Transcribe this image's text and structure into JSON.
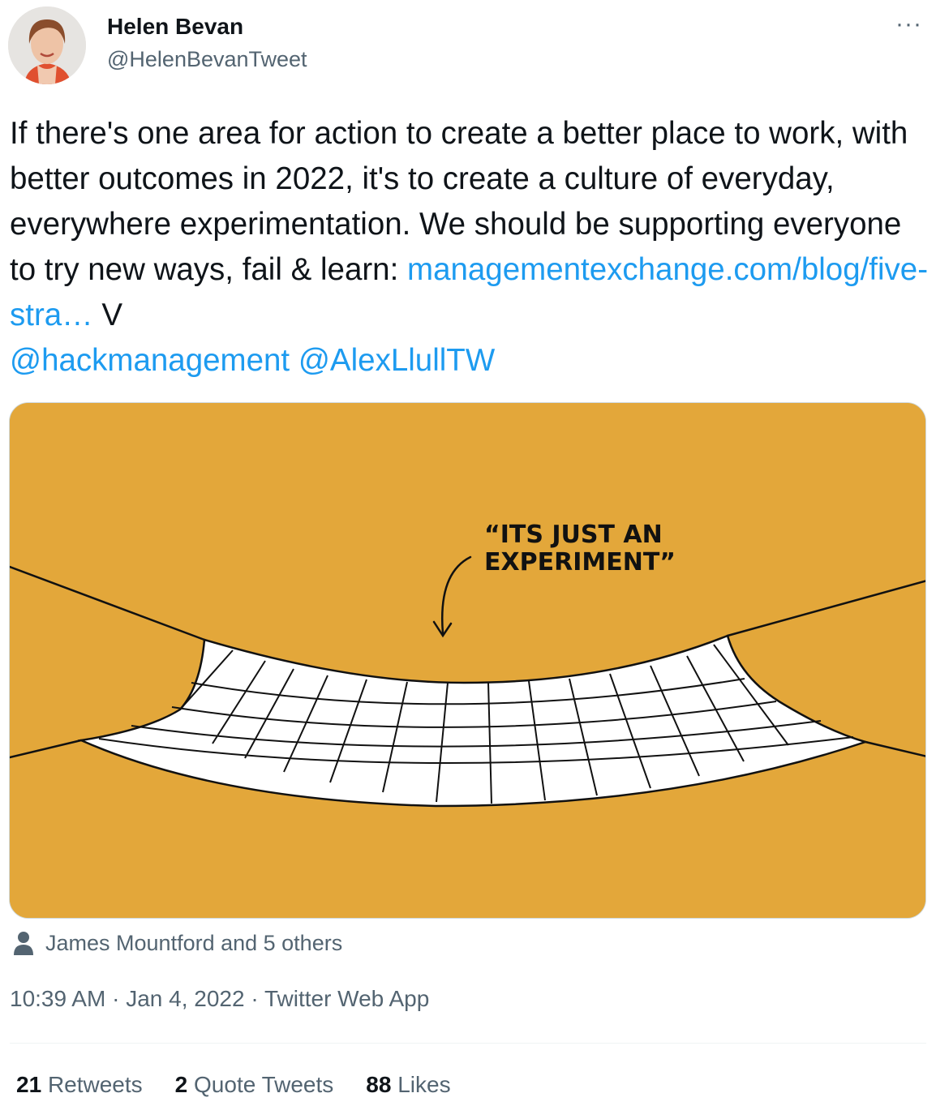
{
  "author": {
    "name": "Helen Bevan",
    "handle": "@HelenBevanTweet"
  },
  "more_label": "···",
  "tweet": {
    "text_1": "If there's one area for action to create a better place to work, with better outcomes in 2022, it's to create a culture of everyday, everywhere experimentation. We should be supporting everyone to try new ways, fail & learn: ",
    "link": "managementexchange.com/blog/five-stra…",
    "text_2": " V ",
    "mention_1": "@hackmanagement",
    "mention_2": "@AlexLlullTW"
  },
  "media": {
    "caption_line1": "“ITS JUST AN",
    "caption_line2": "EXPERIMENT”",
    "background": "#e3a73a"
  },
  "tagged": {
    "text": "James Mountford and 5 others",
    "icon": "person-icon"
  },
  "meta": {
    "time": "10:39 AM",
    "date": "Jan 4, 2022",
    "source": "Twitter Web App"
  },
  "stats": {
    "retweets_count": "21",
    "retweets_label": "Retweets",
    "quotes_count": "2",
    "quotes_label": "Quote Tweets",
    "likes_count": "88",
    "likes_label": "Likes"
  },
  "colors": {
    "link": "#1d9bf0",
    "secondary_text": "#536471"
  }
}
